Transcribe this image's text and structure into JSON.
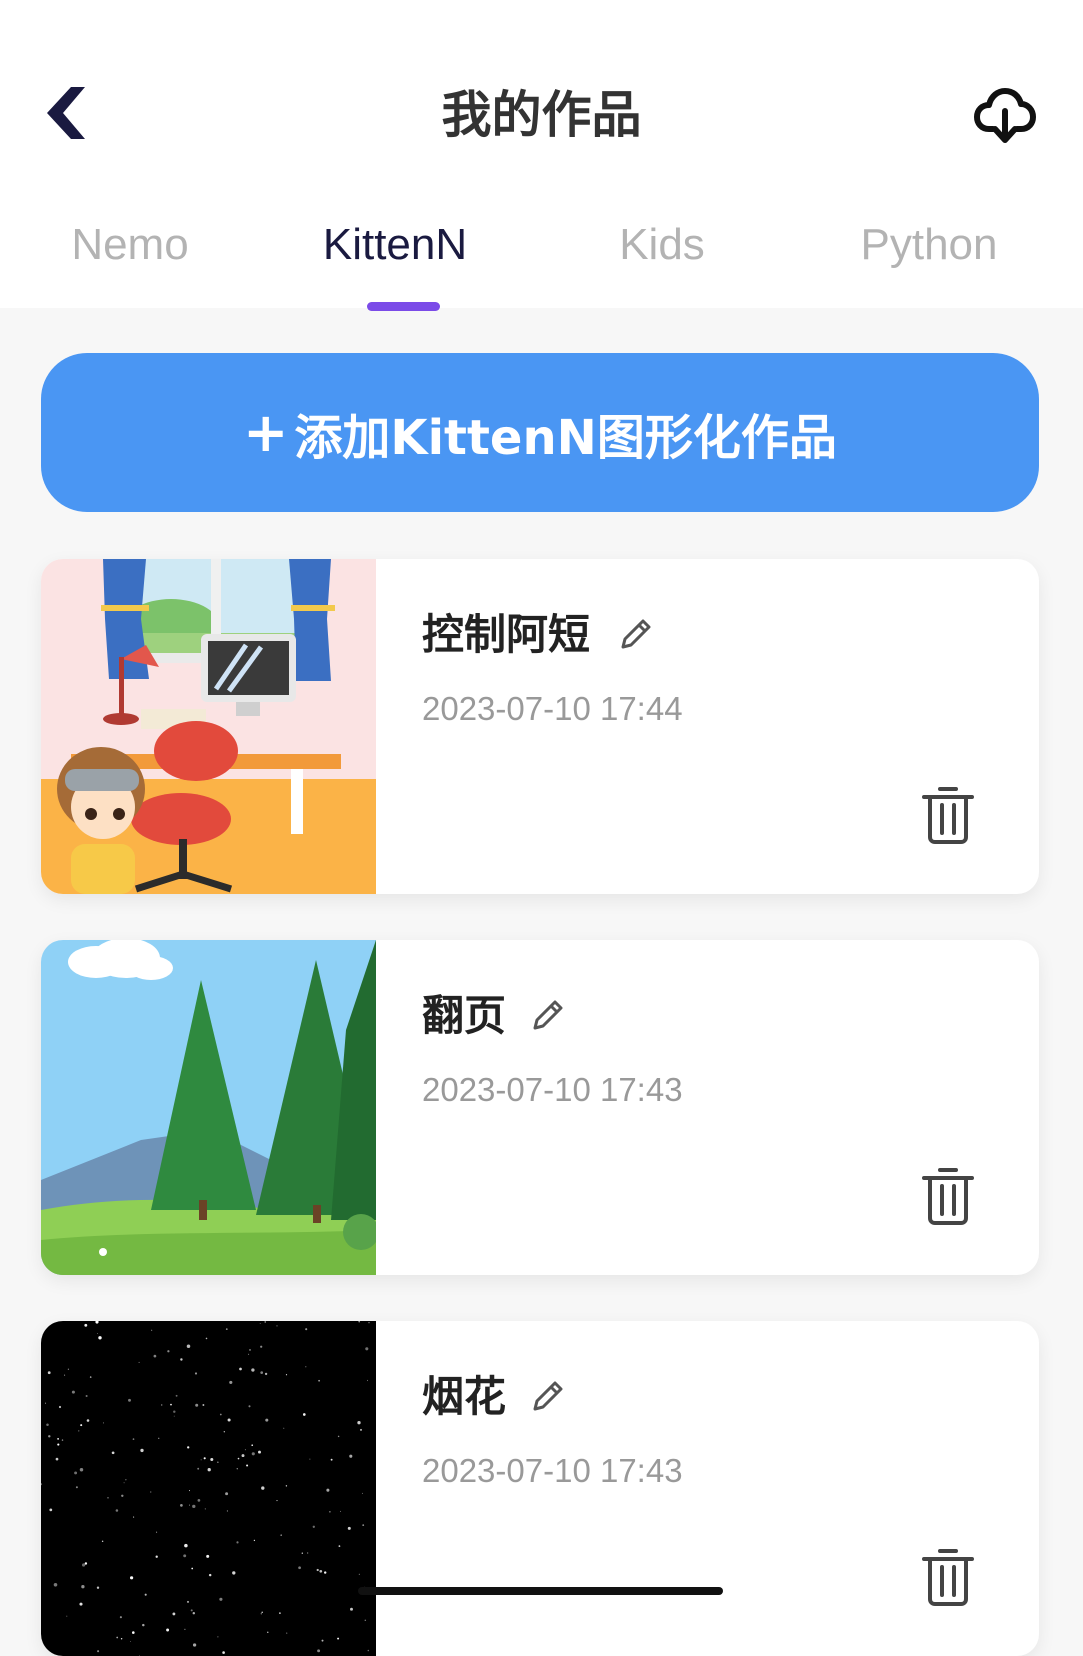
{
  "header": {
    "title": "我的作品",
    "back_icon": "chevron-left-icon",
    "cloud_icon": "cloud-download-icon"
  },
  "tabs": [
    {
      "label": "Nemo",
      "active": false
    },
    {
      "label": "KittenN",
      "active": true
    },
    {
      "label": "Kids",
      "active": false
    },
    {
      "label": "Python",
      "active": false
    }
  ],
  "add_button": {
    "label": "添加KittenN图形化作品",
    "icon": "plus-icon"
  },
  "works": [
    {
      "name": "控制阿短",
      "date": "2023-07-10 17:44",
      "thumbnail": "room-scene-thumbnail"
    },
    {
      "name": "翻页",
      "date": "2023-07-10 17:43",
      "thumbnail": "forest-scene-thumbnail"
    },
    {
      "name": "烟花",
      "date": "2023-07-10 17:43",
      "thumbnail": "starfield-thumbnail"
    }
  ],
  "colors": {
    "accent": "#7b4be8",
    "add_button": "#4a96f3",
    "title_text": "#333333",
    "active_tab": "#1a1a40",
    "inactive_tab": "#b3b3b3",
    "date_text": "#999999",
    "page_bg": "#f7f7f7"
  }
}
